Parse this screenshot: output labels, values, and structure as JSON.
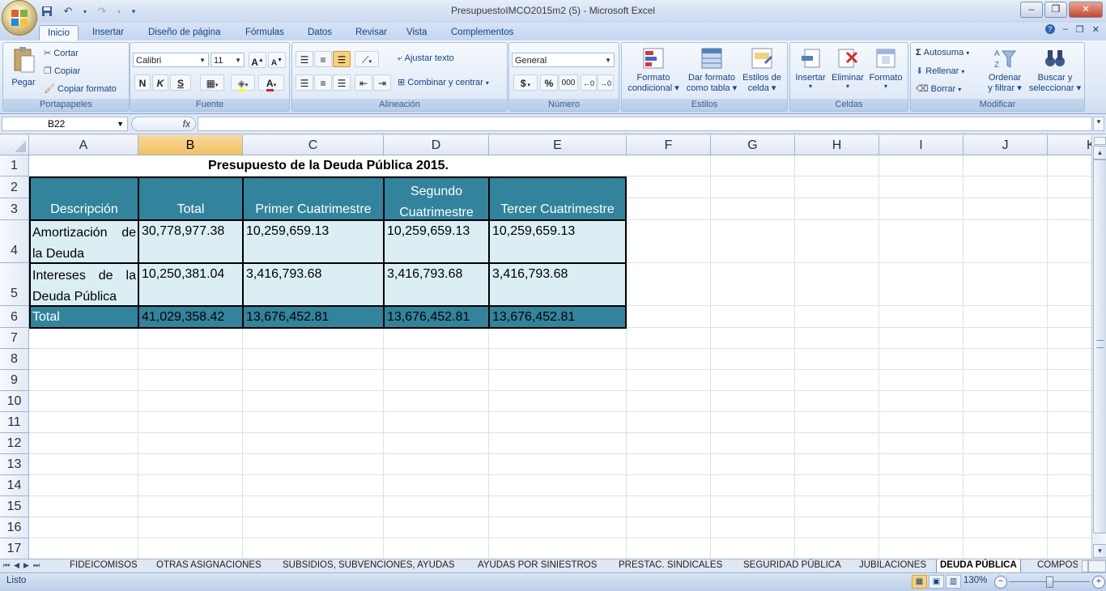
{
  "window": {
    "title": "PresupuestoIMCO2015m2 (5) - Microsoft Excel"
  },
  "tabs": [
    "Inicio",
    "Insertar",
    "Diseño de página",
    "Fórmulas",
    "Datos",
    "Revisar",
    "Vista",
    "Complementos"
  ],
  "ribbon": {
    "portapapeles": {
      "paste": "Pegar",
      "cut": "Cortar",
      "copy": "Copiar",
      "format_painter": "Copiar formato",
      "label": "Portapapeles"
    },
    "fuente": {
      "font": "Calibri",
      "size": "11",
      "bold": "N",
      "italic": "K",
      "underline": "S",
      "label": "Fuente"
    },
    "alineacion": {
      "wrap": "Ajustar texto",
      "merge": "Combinar y centrar",
      "label": "Alineación"
    },
    "numero": {
      "format": "General",
      "currency": "$",
      "percent": "%",
      "thousands": "000",
      "label": "Número"
    },
    "estilos": {
      "cond1": "Formato",
      "cond2": "condicional",
      "table1": "Dar formato",
      "table2": "como tabla",
      "cell1": "Estilos de",
      "cell2": "celda",
      "label": "Estilos"
    },
    "celdas": {
      "insert": "Insertar",
      "delete": "Eliminar",
      "format": "Formato",
      "label": "Celdas"
    },
    "modificar": {
      "autosum": "Autosuma",
      "fill": "Rellenar",
      "clear": "Borrar",
      "sort1": "Ordenar",
      "sort2": "y filtrar",
      "find1": "Buscar y",
      "find2": "seleccionar",
      "label": "Modificar"
    }
  },
  "formula_bar": {
    "name_box": "B22",
    "fx": "fx",
    "content": ""
  },
  "grid": {
    "columns": [
      "A",
      "B",
      "C",
      "D",
      "E",
      "F",
      "G",
      "H",
      "I",
      "J",
      "K"
    ],
    "rows": [
      "1",
      "2",
      "3",
      "4",
      "5",
      "6",
      "7",
      "8",
      "9",
      "10",
      "11",
      "12",
      "13",
      "14",
      "15",
      "16",
      "17"
    ],
    "title": "Presupuesto de la Deuda Pública 2015.",
    "headers": {
      "desc": "Descripción",
      "total": "Total",
      "primer": "Primer Cuatrimestre",
      "segundo1": "Segundo",
      "segundo2": "Cuatrimestre",
      "tercer": "Tercer Cuatrimestre"
    },
    "row4": {
      "desc1": "Amortización de",
      "desc2": "la Deuda",
      "total": "30,778,977.38",
      "c": "10,259,659.13",
      "d": "10,259,659.13",
      "e": "10,259,659.13"
    },
    "row5": {
      "desc1": "Intereses de la",
      "desc2": "Deuda Pública",
      "total": "10,250,381.04",
      "c": "3,416,793.68",
      "d": "3,416,793.68",
      "e": "3,416,793.68"
    },
    "row6": {
      "desc": "Total",
      "total": "41,029,358.42",
      "c": "13,676,452.81",
      "d": "13,676,452.81",
      "e": "13,676,452.81"
    }
  },
  "sheets": [
    "FIDEICOMISOS",
    "OTRAS ASIGNACIONES",
    "SUBSIDIOS, SUBVENCIONES, AYUDAS",
    "AYUDAS POR SINIESTROS",
    "PRESTAC. SINDICALES",
    "SEGURIDAD PÚBLICA",
    "JUBILACIONES",
    "DEUDA PÚBLICA",
    "COMPOSI"
  ],
  "status": {
    "ready": "Listo",
    "zoom": "130%"
  },
  "colors": {
    "header_fill": "#31849b",
    "light_fill": "#dbeef3",
    "selected_header": "#f1c15f"
  }
}
